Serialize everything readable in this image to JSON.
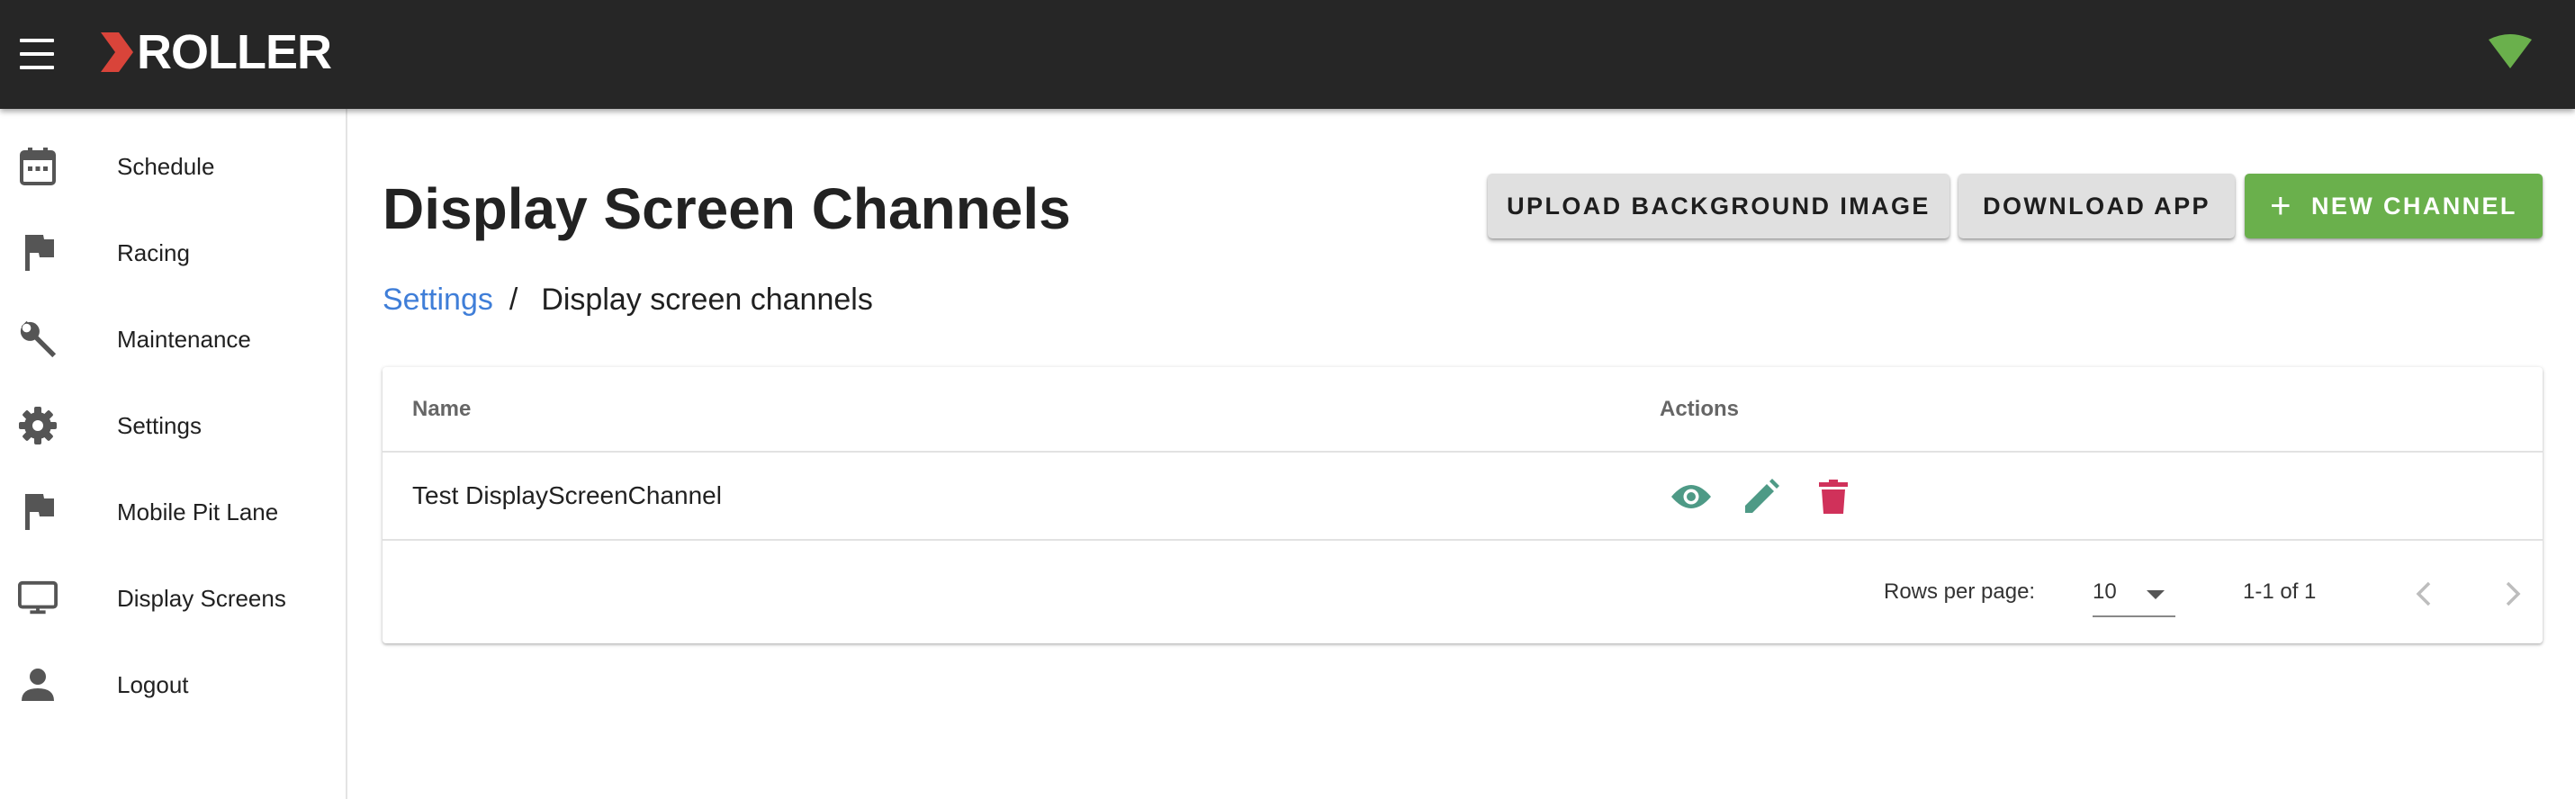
{
  "app": {
    "logo_text": "ROLLER"
  },
  "topbar": {
    "menu_icon": "hamburger-menu-icon",
    "status_icon": "wifi-signal-icon"
  },
  "sidebar": {
    "items": [
      {
        "label": "Schedule",
        "icon": "calendar-icon"
      },
      {
        "label": "Racing",
        "icon": "flag-icon"
      },
      {
        "label": "Maintenance",
        "icon": "wrench-icon"
      },
      {
        "label": "Settings",
        "icon": "gear-icon"
      },
      {
        "label": "Mobile Pit Lane",
        "icon": "flag-icon"
      },
      {
        "label": "Display Screens",
        "icon": "monitor-icon"
      },
      {
        "label": "Logout",
        "icon": "person-icon"
      }
    ]
  },
  "page": {
    "title": "Display Screen Channels",
    "breadcrumb": {
      "parent": "Settings",
      "separator": "/",
      "current": "Display screen channels"
    }
  },
  "toolbar": {
    "upload_label": "UPLOAD BACKGROUND IMAGE",
    "download_label": "DOWNLOAD APP",
    "new_plus": "+",
    "new_label": "NEW CHANNEL"
  },
  "table": {
    "columns": [
      "Name",
      "Actions"
    ],
    "rows": [
      {
        "name": "Test DisplayScreenChannel",
        "actions": [
          "view-icon",
          "edit-icon",
          "delete-icon"
        ]
      }
    ],
    "footer": {
      "rows_per_page_label": "Rows per page:",
      "rows_per_page_value": "10",
      "range_text": "1-1 of 1"
    }
  },
  "colors": {
    "appbar": "#262626",
    "logo_accent": "#d9443a",
    "link": "#3f7ed8",
    "primary_button": "#6ab04c",
    "secondary_button": "#e0e0e0",
    "action_icon": "#4e9a86",
    "delete_icon": "#d0315a",
    "wifi": "#6ab04c"
  }
}
